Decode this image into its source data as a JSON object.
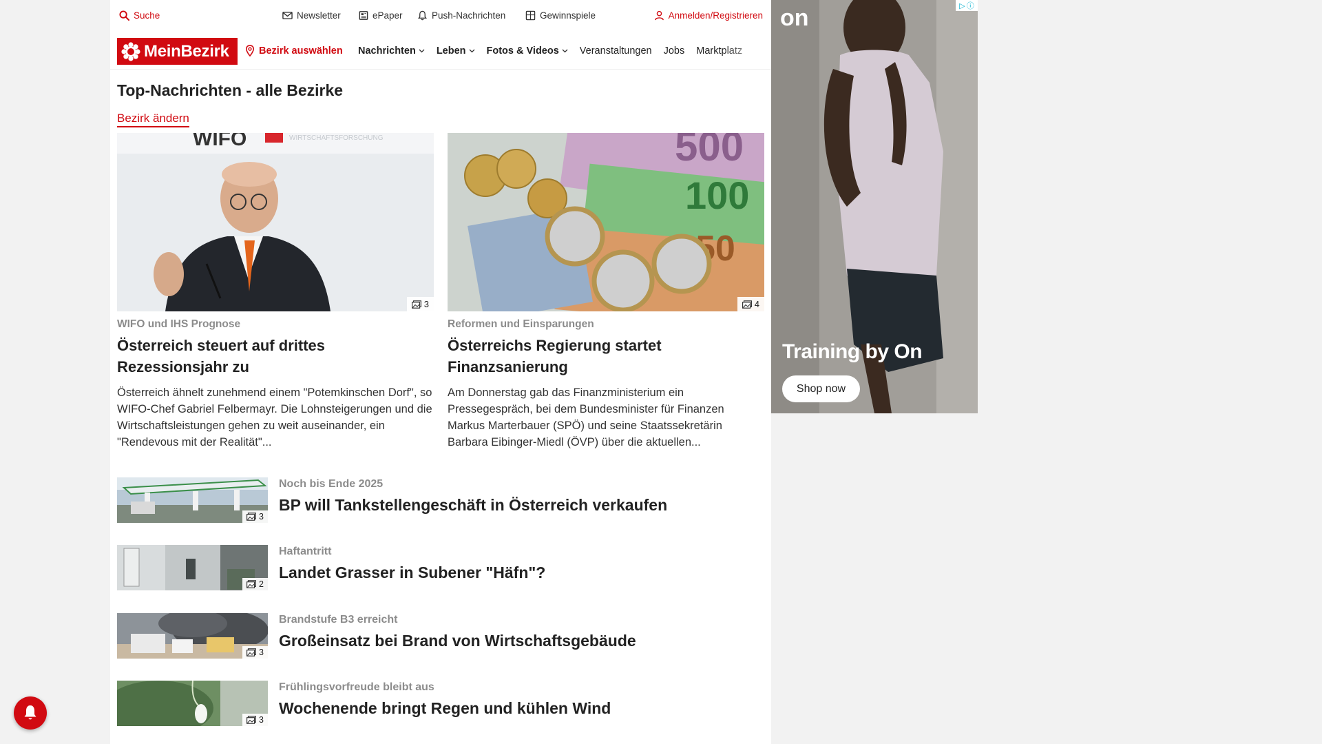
{
  "utility_bar": {
    "search": "Suche",
    "newsletter": "Newsletter",
    "epaper": "ePaper",
    "push": "Push-Nachrichten",
    "gewinnspiele": "Gewinnspiele",
    "login": "Anmelden/Registrieren"
  },
  "nav": {
    "logo": "MeinBezirk",
    "bezirk": "Bezirk auswählen",
    "items": [
      "Nachrichten",
      "Leben",
      "Fotos & Videos",
      "Veranstaltungen",
      "Jobs",
      "Marktplatz"
    ]
  },
  "main": {
    "section_title": "Top-Nachrichten - alle Bezirke",
    "change_link": "Bezirk ändern",
    "top_cards": [
      {
        "kicker": "WIFO und IHS Prognose",
        "title": "Österreich steuert auf drittes Rezessionsjahr zu",
        "teaser": "Österreich ähnelt zunehmend einem \"Potemkinschen Dorf\", so WIFO-Chef Gabriel Felbermayr. Die Lohnsteigerungen und die Wirtschaftsleistungen gehen zu weit auseinander, ein \"Rendevous mit der Realität\"...",
        "image_count": "3"
      },
      {
        "kicker": "Reformen und Einsparungen",
        "title": "Österreichs Regierung startet Finanzsanierung",
        "teaser": "Am Donnerstag gab das Finanzministerium ein Pressegespräch, bei dem Bundesminister für Finanzen Markus Marterbauer (SPÖ) und seine Staatssekretärin Barbara Eibinger-Miedl (ÖVP) über die aktuellen...",
        "image_count": "4"
      }
    ],
    "list": [
      {
        "kicker": "Noch bis Ende 2025",
        "title": "BP will Tankstellengeschäft in Österreich verkaufen",
        "image_count": "3"
      },
      {
        "kicker": "Haftantritt",
        "title": "Landet Grasser in Subener \"Häfn\"?",
        "image_count": "2"
      },
      {
        "kicker": "Brandstufe B3 erreicht",
        "title": "Großeinsatz bei Brand von Wirtschaftsgebäude",
        "image_count": "3"
      },
      {
        "kicker": "Frühlingsvorfreude bleibt aus",
        "title": "Wochenende bringt Regen und kühlen Wind",
        "image_count": "3"
      }
    ]
  },
  "ad": {
    "logo": "on",
    "headline": "Training by On",
    "button": "Shop now"
  },
  "colors": {
    "brand_red": "#d10a11",
    "kicker_gray": "#8c8c8c"
  },
  "icons": {
    "search": "search-icon",
    "newsletter": "envelope-icon",
    "epaper": "newspaper-icon",
    "push": "bell-icon",
    "gewinnspiele": "gift-icon",
    "login": "user-icon",
    "bezirk": "location-pin-icon",
    "image_count": "image-icon"
  }
}
